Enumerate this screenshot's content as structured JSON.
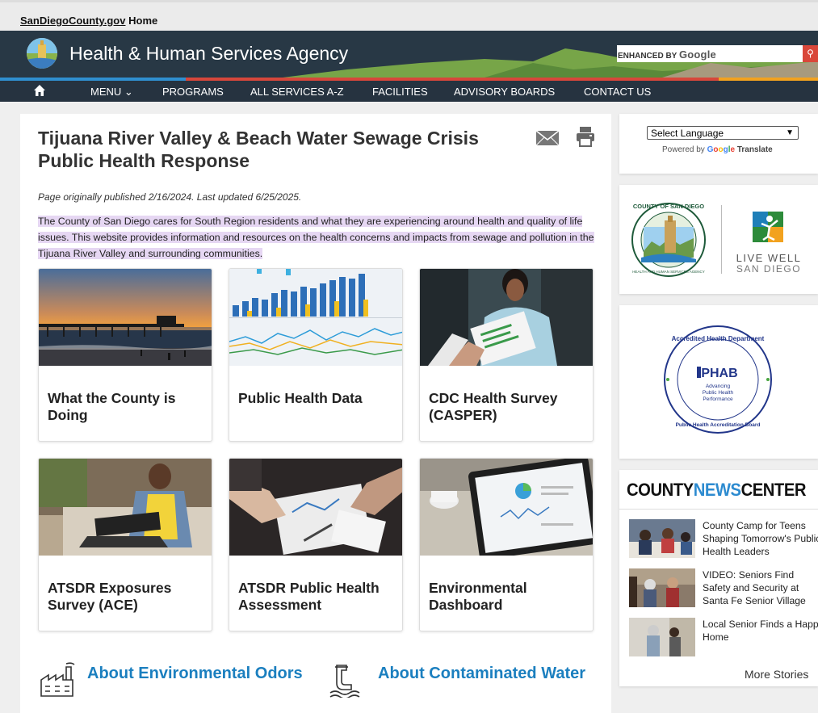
{
  "top": {
    "home_link_site": "SanDiegoCounty.gov",
    "home_link_text": "Home"
  },
  "banner": {
    "title": "Health & Human Services Agency",
    "search_label_prefix": "ENHANCED BY",
    "search_label_brand": "Google",
    "search_icon": "search-icon"
  },
  "nav": {
    "home_icon": "home-icon",
    "items": [
      "MENU ⌄",
      "PROGRAMS",
      "ALL SERVICES A-Z",
      "FACILITIES",
      "ADVISORY BOARDS",
      "CONTACT US"
    ]
  },
  "page": {
    "title": "Tijuana River Valley & Beach Water Sewage Crisis Public Health Response",
    "published": "Page originally published 2/16/2024. Last updated 6/25/2025.",
    "intro": "The County of San Diego cares for South Region residents and what they are experiencing around health and quality of life issues. This website provides information and resources on the health concerns and impacts from sewage and pollution in the Tijuana River Valley and surrounding communities.",
    "cards": [
      {
        "label": "What the County is Doing"
      },
      {
        "label": "Public Health Data"
      },
      {
        "label": "CDC Health Survey (CASPER)"
      },
      {
        "label": "ATSDR Exposures Survey (ACE)"
      },
      {
        "label": "ATSDR Public Health Assessment"
      },
      {
        "label": "Environmental Dashboard"
      }
    ],
    "about": [
      {
        "label": "About Environmental Odors",
        "icon": "factory-icon"
      },
      {
        "label": "About Contaminated Water",
        "icon": "water-faucet-icon"
      }
    ]
  },
  "sidebar": {
    "language_select": "Select Language",
    "powered_by": "Powered by",
    "powered_google": "Google",
    "powered_translate": "Translate",
    "county_seal_text": "COUNTY OF SAN DIEGO",
    "seal_bottom_text": "HEALTH AND HUMAN SERVICES AGENCY",
    "live_well_1": "LIVE WELL",
    "live_well_2": "SAN DIEGO",
    "phab_ring_top": "Accredited Health Department",
    "phab_ring_bottom": "Public Health Accreditation Board",
    "phab_name": "PHAB",
    "phab_tag_1": "Advancing",
    "phab_tag_2": "Public Health",
    "phab_tag_3": "Performance",
    "news_title_1": "COUNTY",
    "news_title_2": "NEWS",
    "news_title_3": "CENTER",
    "news": [
      "County Camp for Teens Shaping Tomorrow's Public Health Leaders",
      "VIDEO: Seniors Find Safety and Security at Santa Fe Senior Village",
      "Local Senior Finds a Happy Home"
    ],
    "more": "More Stories"
  },
  "colors": {
    "banner_bg": "#283845",
    "nav_bg": "#263340",
    "accent_blue": "#1b7fbf",
    "highlight": "#e6d7f3",
    "stripe_blue": "#2f8fd0",
    "stripe_red": "#d7473b",
    "stripe_orange": "#f2a21f"
  }
}
